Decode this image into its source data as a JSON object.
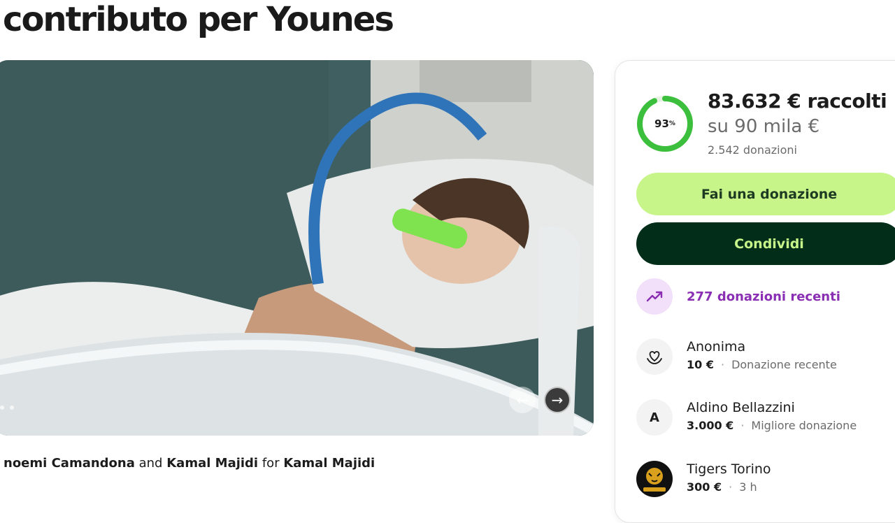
{
  "page": {
    "title": "contributo per Younes"
  },
  "carousel": {
    "prev_icon": "←",
    "next_icon": "→"
  },
  "organizers": {
    "name1": "noemi Camandona",
    "and": "and",
    "name2": "Kamal Majidi",
    "for": "for",
    "beneficiary": "Kamal Majidi"
  },
  "stats": {
    "percent": "93",
    "percent_sign": "%",
    "progress": 0.93,
    "raised": "83.632 € raccolti",
    "goal": "su 90 mila €",
    "donations": "2.542 donazioni"
  },
  "buttons": {
    "donate": "Fai una donazione",
    "share": "Condividi"
  },
  "recent": {
    "label": "277 donazioni recenti"
  },
  "donors": [
    {
      "name": "Anonima",
      "amount": "10 €",
      "sep": "·",
      "note": "Donazione recente",
      "avatar_icon": "heart-hands-icon"
    },
    {
      "name": "Aldino Bellazzini",
      "amount": "3.000 €",
      "sep": "·",
      "note": "Migliore donazione",
      "avatar_initial": "A"
    },
    {
      "name": "Tigers Torino",
      "amount": "300 €",
      "sep": "·",
      "note": "3 h",
      "avatar_icon": "tiger-logo-icon"
    }
  ],
  "colors": {
    "accent_green": "#c7f58a",
    "dark_green": "#012d19",
    "ring_green": "#3cbf3c",
    "purple": "#8a2fb3"
  }
}
